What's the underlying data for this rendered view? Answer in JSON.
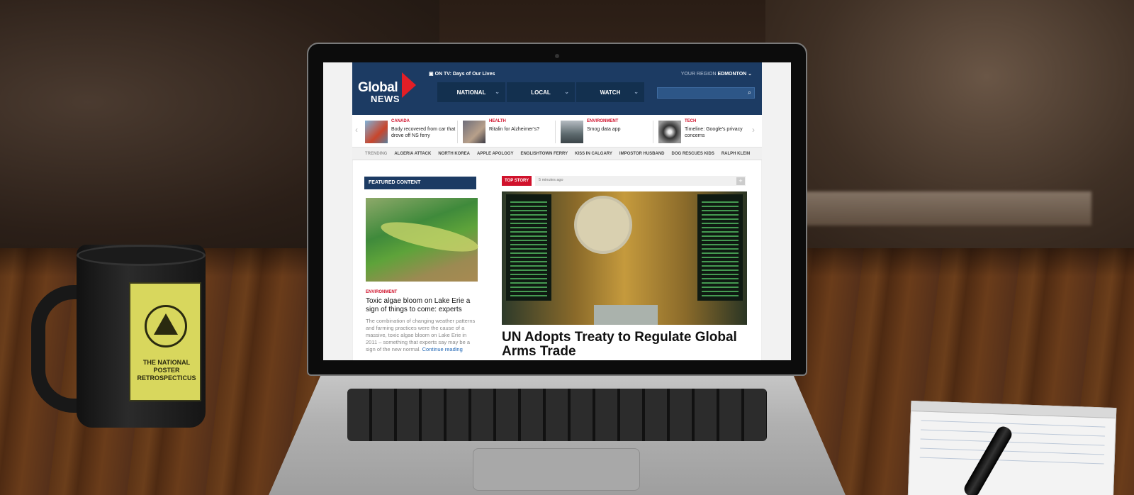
{
  "site": {
    "logo_top": "Global",
    "logo_bottom": "NEWS",
    "on_tv": "ON TV: Days of Our Lives",
    "region_label": "YOUR REGION",
    "region_value": "EDMONTON ⌄",
    "nav": [
      {
        "label": "NATIONAL"
      },
      {
        "label": "LOCAL"
      },
      {
        "label": "WATCH"
      }
    ],
    "brand_color": "#1c3b63",
    "accent_color": "#d0112b"
  },
  "stories": [
    {
      "category": "CANADA",
      "headline": "Body recovered from car that drove off NS ferry"
    },
    {
      "category": "HEALTH",
      "headline": "Ritalin for Alzheimer's?"
    },
    {
      "category": "ENVIRONMENT",
      "headline": "Smog data app"
    },
    {
      "category": "TECH",
      "headline": "Timeline: Google's privacy concerns"
    }
  ],
  "trending": {
    "label": "TRENDING",
    "items": [
      "ALGERIA ATTACK",
      "NORTH KOREA",
      "APPLE APOLOGY",
      "ENGLISHTOWN FERRY",
      "KISS IN CALGARY",
      "IMPOSTOR HUSBAND",
      "DOG RESCUES KIDS",
      "RALPH KLEIN"
    ]
  },
  "featured": {
    "heading": "FEATURED CONTENT",
    "category": "ENVIRONMENT",
    "title": "Toxic algae bloom on Lake Erie a sign of things to come: experts",
    "body": "The combination of changing weather patterns and farming practices were the cause of a massive, toxic algae bloom on Lake Erie in 2011 – something that experts say may be a sign of the new normal.",
    "more": "Continue reading"
  },
  "top_story": {
    "badge": "TOP STORY",
    "time": "5 minutes ago",
    "title": "UN Adopts Treaty to Regulate Global Arms Trade"
  },
  "mug": {
    "caption": "THE NATIONAL POSTER RETROSPECTICUS"
  }
}
